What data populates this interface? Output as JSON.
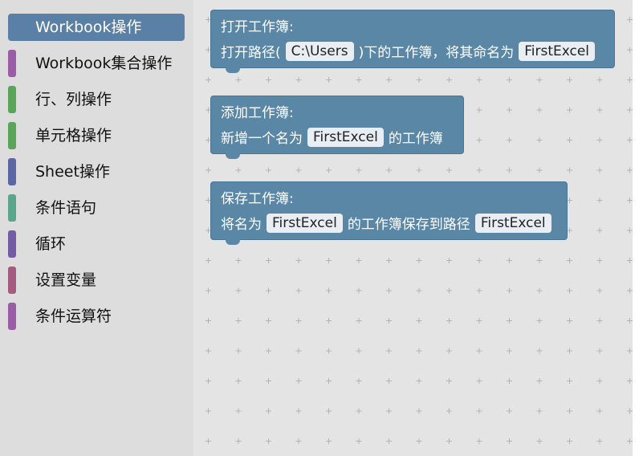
{
  "toolbox": {
    "categories": [
      {
        "label": "Workbook操作",
        "color": "#5b80a5",
        "selected": true
      },
      {
        "label": "Workbook集合操作",
        "color": "#9a5ca6"
      },
      {
        "label": "行、列操作",
        "color": "#5ba55b"
      },
      {
        "label": "单元格操作",
        "color": "#5ba55b"
      },
      {
        "label": "Sheet操作",
        "color": "#5b67a5"
      },
      {
        "label": "条件语句",
        "color": "#5ba58c"
      },
      {
        "label": "循环",
        "color": "#745ba5"
      },
      {
        "label": "设置变量",
        "color": "#a55b80"
      },
      {
        "label": "条件运算符",
        "color": "#9a5ca6"
      }
    ]
  },
  "blocks": {
    "open": {
      "title": "打开工作簿:",
      "text1": "打开路径(",
      "path": "C:\\Users",
      "text2": ")下的工作簿，将其命名为",
      "name": "FirstExcel"
    },
    "add": {
      "title": "添加工作簿:",
      "text1": "新增一个名为",
      "name": "FirstExcel",
      "text2": "的工作簿"
    },
    "save": {
      "title": "保存工作簿:",
      "text1": "将名为",
      "name": "FirstExcel",
      "text2": "的工作簿保存到路径",
      "path": "FirstExcel"
    }
  },
  "colors": {
    "block": "#5b87a6",
    "workspace": "#e4e4e4",
    "toolbox": "#dddddd"
  }
}
